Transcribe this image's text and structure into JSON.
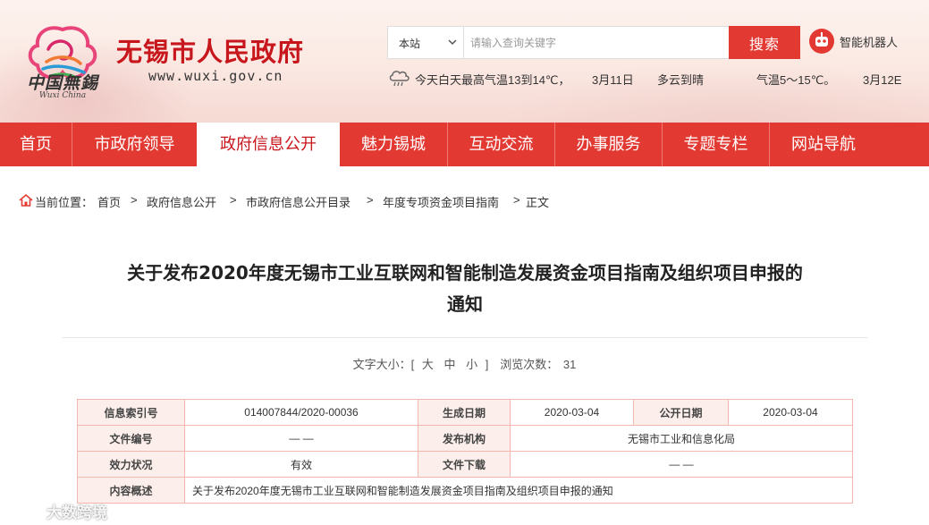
{
  "header": {
    "logo_cn": "中国無錫",
    "logo_en": "Wuxi China",
    "site_name": "无锡市人民政府",
    "site_url": "www.wuxi.gov.cn"
  },
  "search": {
    "scope": "本站",
    "placeholder": "请输入查询关键字",
    "button": "搜索"
  },
  "robot": {
    "label": "智能机器人"
  },
  "weather": {
    "items": [
      "今天白天最高气温13到14℃，",
      "3月11日",
      "多云到晴",
      "气温5～15℃。",
      "3月12E"
    ]
  },
  "nav": {
    "items": [
      {
        "label": "首页"
      },
      {
        "label": "市政府领导"
      },
      {
        "label": "政府信息公开",
        "active": true
      },
      {
        "label": "魅力锡城"
      },
      {
        "label": "互动交流"
      },
      {
        "label": "办事服务"
      },
      {
        "label": "专题专栏"
      },
      {
        "label": "网站导航"
      }
    ]
  },
  "breadcrumb": {
    "prefix": "当前位置：",
    "items": [
      "首页",
      "政府信息公开",
      "市政府信息公开目录",
      "年度专项资金项目指南",
      "正文"
    ],
    "separator": ">"
  },
  "article": {
    "title_line1": "关于发布2020年度无锡市工业互联网和智能制造发展资金项目指南及组织项目申报的",
    "title_line2": "通知",
    "font_size_label": "文字大小：[",
    "size_large": "大",
    "size_medium": "中",
    "size_small": "小",
    "font_size_close": "]",
    "views_label": "浏览次数：",
    "views": "31"
  },
  "info_table": {
    "index_label": "信息索引号",
    "index_value": "014007844/2020-00036",
    "generated_label": "生成日期",
    "generated_value": "2020-03-04",
    "public_label": "公开日期",
    "public_value": "2020-03-04",
    "doc_no_label": "文件编号",
    "doc_no_value": "— —",
    "org_label": "发布机构",
    "org_value": "无锡市工业和信息化局",
    "status_label": "效力状况",
    "status_value": "有效",
    "download_label": "文件下载",
    "download_value": "— —",
    "summary_label": "内容概述",
    "summary_value": "关于发布2020年度无锡市工业互联网和智能制造发展资金项目指南及组织项目申报的通知"
  },
  "watermark": {
    "text": "大数跨境"
  },
  "colors": {
    "brand_red": "#e23a33",
    "title_red": "#c8161d",
    "table_border": "#f2b8b0",
    "table_key_bg": "#fcefeb"
  }
}
